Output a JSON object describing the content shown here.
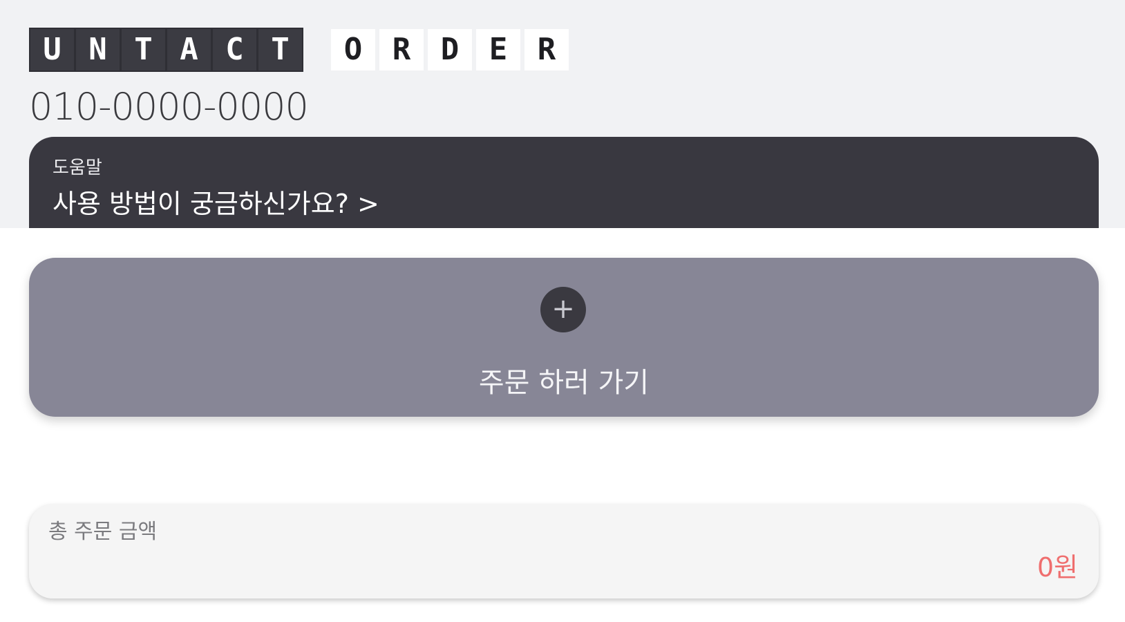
{
  "logo": {
    "dark_letters": [
      "U",
      "N",
      "T",
      "A",
      "C",
      "T"
    ],
    "light_letters": [
      "O",
      "R",
      "D",
      "E",
      "R"
    ]
  },
  "phone": "010-0000-0000",
  "help": {
    "label": "도움말",
    "link_text": "사용 방법이 궁금하신가요? >"
  },
  "order": {
    "icon": "plus-icon",
    "icon_glyph": "+",
    "label": "주문 하러 가기"
  },
  "total": {
    "label": "총 주문 금액",
    "value": "0원",
    "value_color": "#ef6e6e"
  },
  "colors": {
    "header_bg": "#f1f2f4",
    "help_card": "#393840",
    "order_card": "#878696"
  }
}
